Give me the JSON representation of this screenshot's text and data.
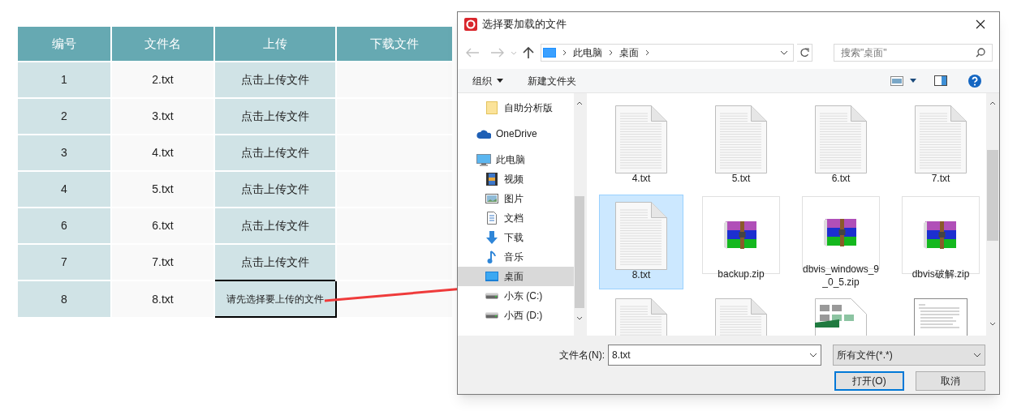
{
  "table": {
    "columns": [
      "编号",
      "文件名",
      "上传",
      "下载文件"
    ],
    "rows": [
      {
        "id": "1",
        "file": "2.txt",
        "upload": "点击上传文件",
        "focused": false
      },
      {
        "id": "2",
        "file": "3.txt",
        "upload": "点击上传文件",
        "focused": false
      },
      {
        "id": "3",
        "file": "4.txt",
        "upload": "点击上传文件",
        "focused": false
      },
      {
        "id": "4",
        "file": "5.txt",
        "upload": "点击上传文件",
        "focused": false
      },
      {
        "id": "6",
        "file": "6.txt",
        "upload": "点击上传文件",
        "focused": false
      },
      {
        "id": "7",
        "file": "7.txt",
        "upload": "点击上传文件",
        "focused": false
      },
      {
        "id": "8",
        "file": "8.txt",
        "upload": "请先选择要上传的文件",
        "focused": true
      }
    ]
  },
  "dialog": {
    "title": "选择要加载的文件",
    "breadcrumb": [
      "此电脑",
      "桌面"
    ],
    "search": {
      "placeholder": "搜索\"桌面\""
    },
    "toolbar": {
      "organize": "组织",
      "new_folder": "新建文件夹"
    },
    "sidebar": {
      "items": [
        {
          "label": "自助分析版",
          "kind": "folder",
          "selected": false
        },
        {
          "label": "OneDrive",
          "kind": "cloud",
          "selected": false
        },
        {
          "label": "此电脑",
          "kind": "computer",
          "selected": false,
          "children": [
            {
              "label": "视频",
              "kind": "video",
              "selected": false
            },
            {
              "label": "图片",
              "kind": "pictures",
              "selected": false
            },
            {
              "label": "文档",
              "kind": "documents",
              "selected": false
            },
            {
              "label": "下载",
              "kind": "downloads",
              "selected": false
            },
            {
              "label": "音乐",
              "kind": "music",
              "selected": false
            },
            {
              "label": "桌面",
              "kind": "desktop",
              "selected": true
            },
            {
              "label": "小东 (C:)",
              "kind": "drive",
              "selected": false
            },
            {
              "label": "小西 (D:)",
              "kind": "drive",
              "selected": false
            }
          ]
        }
      ]
    },
    "files": [
      {
        "name": "4.txt",
        "kind": "text",
        "selected": false
      },
      {
        "name": "5.txt",
        "kind": "text",
        "selected": false
      },
      {
        "name": "6.txt",
        "kind": "text",
        "selected": false
      },
      {
        "name": "7.txt",
        "kind": "text",
        "selected": false
      },
      {
        "name": "8.txt",
        "kind": "text",
        "selected": true
      },
      {
        "name": "backup.zip",
        "kind": "archive",
        "selected": false
      },
      {
        "name": "dbvis_windows_9_0_5.zip",
        "kind": "archive",
        "selected": false
      },
      {
        "name": "dbvis破解.zip",
        "kind": "archive",
        "selected": false
      },
      {
        "kind": "text",
        "selected": false
      },
      {
        "kind": "text",
        "selected": false
      },
      {
        "kind": "spreadsheet",
        "selected": false
      },
      {
        "kind": "document",
        "selected": false
      }
    ],
    "filename_label": "文件名(N):",
    "filename": "8.txt",
    "filter": "所有文件(*.*)",
    "buttons": [
      {
        "label": "打开(O)",
        "default": true
      },
      {
        "label": "取消",
        "default": false
      }
    ]
  }
}
